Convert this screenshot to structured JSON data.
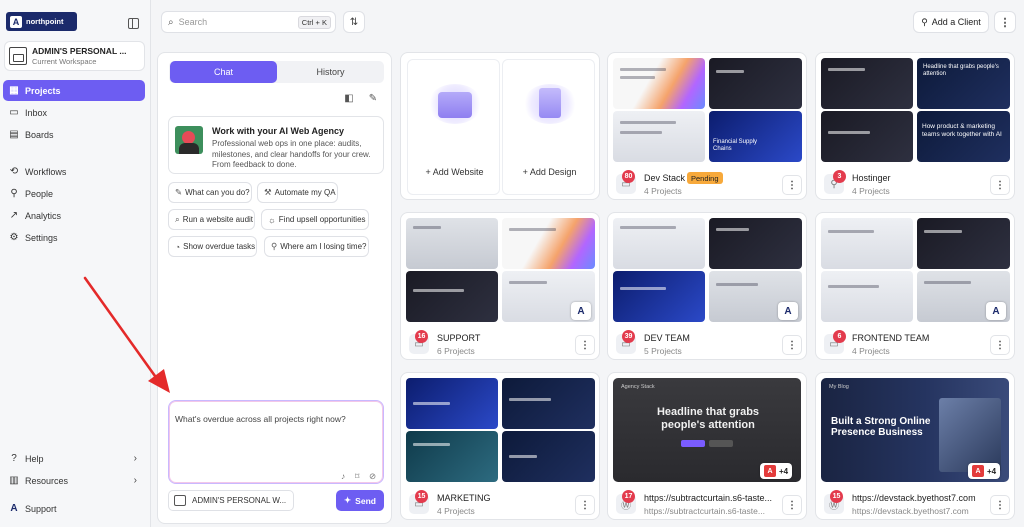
{
  "sidebar": {
    "logo_text": "northpoint",
    "workspace": {
      "title": "ADMIN'S PERSONAL ...",
      "subtitle": "Current Workspace"
    },
    "nav": [
      {
        "label": "Projects",
        "icon": "grid-icon",
        "active": true
      },
      {
        "label": "Inbox",
        "icon": "inbox-icon"
      },
      {
        "label": "Boards",
        "icon": "board-icon"
      },
      {
        "label": "Workflows",
        "icon": "workflow-icon"
      },
      {
        "label": "People",
        "icon": "person-icon"
      },
      {
        "label": "Analytics",
        "icon": "chart-icon"
      },
      {
        "label": "Settings",
        "icon": "gear-icon"
      }
    ],
    "bottom": [
      {
        "label": "Help",
        "icon": "help-icon"
      },
      {
        "label": "Resources",
        "icon": "resources-icon"
      }
    ],
    "support_label": "Support"
  },
  "topbar": {
    "search_placeholder": "Search",
    "search_shortcut": "Ctrl + K",
    "add_client_label": "Add a Client"
  },
  "chat": {
    "tabs": [
      "Chat",
      "History"
    ],
    "agency": {
      "title": "Work with your AI Web Agency",
      "description": "Professional web ops in one place: audits, milestones, and clear handoffs for your crew. From feedback to done."
    },
    "suggestions": [
      "What can you do?",
      "Automate my QA",
      "Run a website audit",
      "Find upsell opportunities",
      "Show overdue tasks",
      "Where am I losing time?"
    ],
    "prompt_text": "What's overdue across all projects right now?",
    "workspace_select": "ADMIN'S PERSONAL W...",
    "send_label": "Send"
  },
  "add_card": {
    "website_label": "+ Add Website",
    "design_label": "+ Add Design"
  },
  "cards": [
    {
      "name": "Dev Stack",
      "sub": "4 Projects",
      "count": "80",
      "badge": "Pending"
    },
    {
      "name": "Hostinger",
      "sub": "4 Projects",
      "count": "3"
    },
    {
      "name": "SUPPORT",
      "sub": "6 Projects",
      "count": "16"
    },
    {
      "name": "DEV TEAM",
      "sub": "5 Projects",
      "count": "39"
    },
    {
      "name": "FRONTEND TEAM",
      "sub": "4 Projects",
      "count": "6"
    },
    {
      "name": "MARKETING",
      "sub": "4 Projects",
      "count": "15"
    },
    {
      "name": "https://subtractcurtain.s6-taste...",
      "sub": "https://subtractcurtain.s6-taste...",
      "count": "17",
      "multi": "+4",
      "headline": "Headline that grabs people's attention",
      "brand": "Agency Stack"
    },
    {
      "name": "https://devstack.byethost7.com",
      "sub": "https://devstack.byethost7.com",
      "count": "15",
      "multi": "+4",
      "headline": "Built a Strong Online Presence Business",
      "brand": "My Blog"
    }
  ],
  "thumb_texts": {
    "financial": "Financial Supply Chains",
    "hostinger_head": "Headline that grabs people's attention",
    "hostinger_team": "How product & marketing teams work together with AI"
  },
  "colors": {
    "accent": "#6d5df2",
    "badge_red": "#e33b4d",
    "pending": "#f7a93b",
    "brand_navy": "#1b2a6b"
  }
}
